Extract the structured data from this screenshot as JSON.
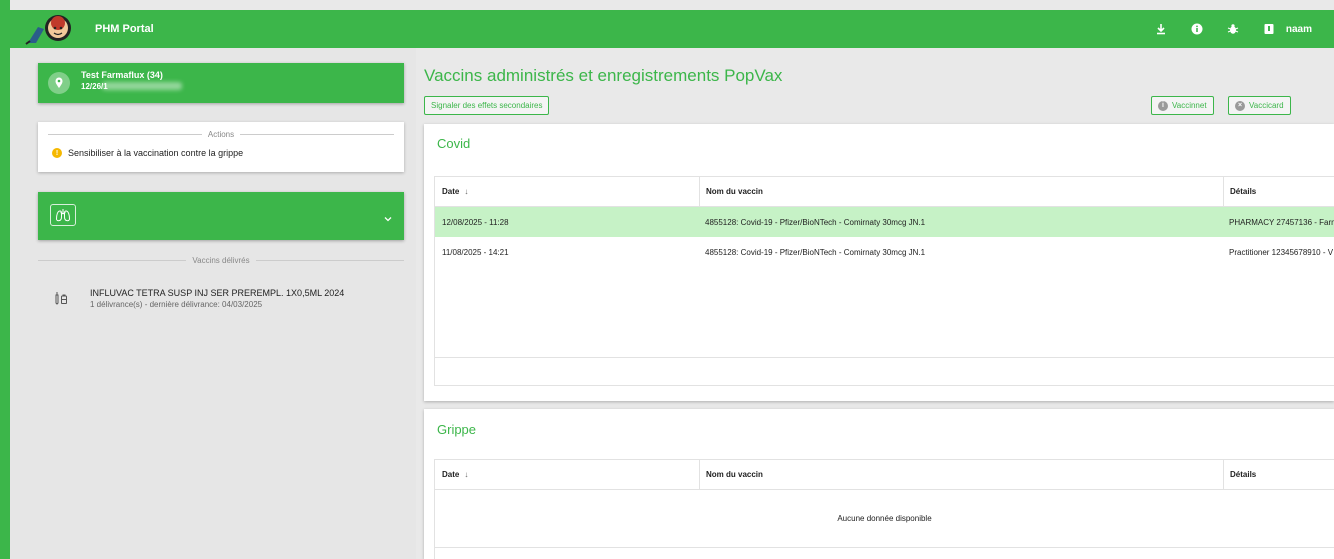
{
  "header": {
    "app_title": "PHM Portal",
    "user": "naam",
    "icons": [
      "download-icon",
      "info-icon",
      "bug-icon",
      "user-card-icon"
    ]
  },
  "sidebar": {
    "patient": {
      "name": "Test Farmaflux (34)",
      "dob": "12/26/1"
    },
    "actions": {
      "heading": "Actions",
      "items": [
        {
          "label": "Sensibiliser à la vaccination contre la grippe",
          "icon": "warning-icon"
        }
      ]
    },
    "delivered": {
      "heading": "Vaccins délivrés",
      "items": [
        {
          "name": "INFLUVAC TETRA SUSP INJ SER PREREMPL. 1X0,5ML 2024",
          "detail": "1 délivrance(s) - dernière délivrance: 04/03/2025",
          "icon": "syringe-vial-icon"
        }
      ]
    }
  },
  "main": {
    "title": "Vaccins administrés et enregistrements PopVax",
    "report_button": "Signaler des effets secondaires",
    "vaccinnet_button": "Vaccinnet",
    "vaccicard_button": "Vaccicard",
    "covid": {
      "title": "Covid",
      "columns": [
        "Date",
        "Nom du vaccin",
        "Détails"
      ],
      "rows": [
        {
          "date": "12/08/2025 - 11:28",
          "vaccine": "4855128: Covid-19 - Pfizer/BioNTech - Comirnaty 30mcg JN.1",
          "details": "PHARMACY 27457136 - Farm"
        },
        {
          "date": "11/08/2025 - 14:21",
          "vaccine": "4855128: Covid-19 - Pfizer/BioNTech - Comirnaty 30mcg JN.1",
          "details": "Practitioner 12345678910 - V"
        }
      ]
    },
    "grippe": {
      "title": "Grippe",
      "columns": [
        "Date",
        "Nom du vaccin",
        "Détails"
      ],
      "empty": "Aucune donnée disponible"
    }
  },
  "colors": {
    "brand_green": "#3cb64a",
    "row_highlight": "#c6f2c6",
    "warning": "#f5b800"
  }
}
